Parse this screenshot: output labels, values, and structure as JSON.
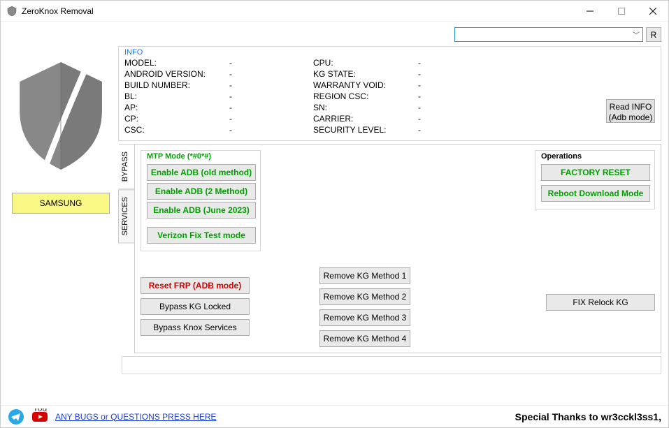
{
  "window": {
    "title": "ZeroKnox Removal"
  },
  "top": {
    "combo_value": "",
    "r_label": "R"
  },
  "brand_button": "SAMSUNG",
  "info": {
    "legend": "INFO",
    "left": [
      {
        "label": "MODEL:",
        "value": "-"
      },
      {
        "label": "ANDROID VERSION:",
        "value": "-"
      },
      {
        "label": "BUILD NUMBER:",
        "value": "-"
      },
      {
        "label": "BL:",
        "value": "-"
      },
      {
        "label": "AP:",
        "value": "-"
      },
      {
        "label": "CP:",
        "value": "-"
      },
      {
        "label": "CSC:",
        "value": "-"
      }
    ],
    "right": [
      {
        "label": "CPU:",
        "value": "-",
        "red": false
      },
      {
        "label": "KG STATE:",
        "value": "-",
        "red": true
      },
      {
        "label": "WARRANTY VOID:",
        "value": "-",
        "red": false
      },
      {
        "label": "REGION CSC:",
        "value": "-",
        "red": false
      },
      {
        "label": "SN:",
        "value": "-",
        "red": false
      },
      {
        "label": "CARRIER:",
        "value": "-",
        "red": false
      },
      {
        "label": "SECURITY LEVEL:",
        "value": "-",
        "red": false
      }
    ],
    "readinfo_line1": "Read INFO",
    "readinfo_line2": "(Adb mode)"
  },
  "tabs": {
    "bypass": "BYPASS",
    "services": "SERVICES"
  },
  "mtp": {
    "legend": "MTP Mode (*#0*#)",
    "btn1": "Enable ADB (old method)",
    "btn2": "Enable ADB (2 Method)",
    "btn3": "Enable ADB (June 2023)",
    "btn4": "Verizon Fix Test mode"
  },
  "ops": {
    "legend": "Operations",
    "factory": "FACTORY RESET",
    "reboot": "Reboot Download Mode"
  },
  "bottom": {
    "reset_frp": "Reset FRP (ADB mode)",
    "bypass_kg": "Bypass KG Locked",
    "bypass_knox": "Bypass Knox Services",
    "kg1": "Remove KG Method 1",
    "kg2": "Remove KG Method 2",
    "kg3": "Remove KG Method 3",
    "kg4": "Remove KG Method 4",
    "fix_relock": "FIX Relock KG"
  },
  "footer": {
    "bugs": "ANY BUGS or QUESTIONS PRESS HERE",
    "thanks": "Special Thanks to wr3cckl3ss1,"
  }
}
